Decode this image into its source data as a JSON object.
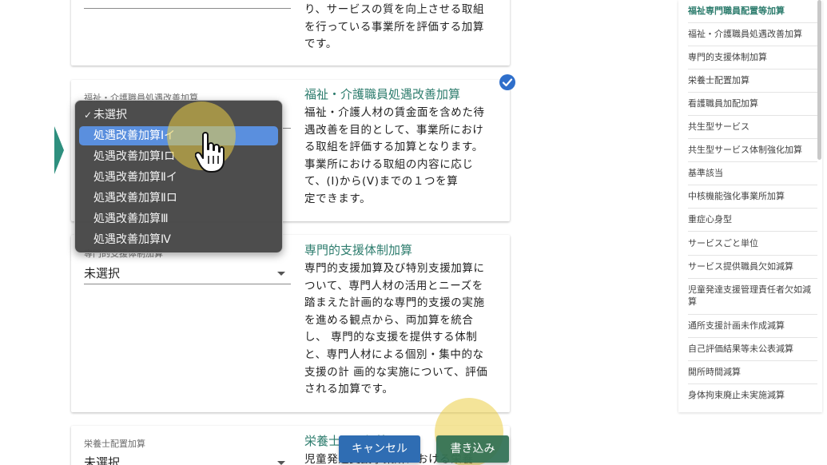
{
  "card0": {
    "desc_lines": [
      "り、サービスの質を向上させる取組",
      "を行っている事業所を評価する加算",
      "です。"
    ]
  },
  "card1": {
    "label": "福祉・介護職員処遇改善加算",
    "title": "福祉・介護職員処遇改善加算",
    "desc_lines": [
      "福祉・介護人材の賃金面を含めた待",
      "遇改善を目的として、事業所におけ",
      "る取組を評価する加算となります。",
      "事業所における取組の内容に応じ",
      "て、(Ⅰ)から(Ⅴ)までの１つを算",
      "定できます。"
    ],
    "checked": true
  },
  "dropdown": {
    "check_mark": "✓",
    "options": [
      "未選択",
      "処遇改善加算Ⅰイ",
      "処遇改善加算Ⅰロ",
      "処遇改善加算Ⅱイ",
      "処遇改善加算Ⅱロ",
      "処遇改善加算Ⅲ",
      "処遇改善加算Ⅳ"
    ],
    "checked_option": "未選択",
    "hovered_option": "処遇改善加算Ⅰイ"
  },
  "card2": {
    "label": "専門的支援体制加算",
    "value": "未選択",
    "title": "専門的支援体制加算",
    "desc_lines": [
      "専門的支援加算及び特別支援加算に",
      "ついて、専門人材の活用とニーズを",
      "踏まえた計画的な専門的支援の実施",
      "を進める観点から、両加算を統合",
      "し、 専門的な支援を提供する体制",
      "と、専門人材による個別・集中的な",
      "支援の計 画的な実施について、評価",
      "される加算です。"
    ]
  },
  "card3": {
    "label": "栄養士配置加算",
    "value": "未選択",
    "title": "栄養士配置加算",
    "desc_lines": [
      "児童発達支援事業所における栄養"
    ]
  },
  "buttons": {
    "cancel": "キャンセル",
    "save": "書き込み"
  },
  "colors": {
    "cancel": "#2f6db3",
    "save": "#2e6f52",
    "accent": "#2e7d6e",
    "check": "#2f6fcb",
    "arrow": "#2e8f7e"
  },
  "side_nav": {
    "items": [
      "福祉専門職員配置等加算",
      "福祉・介護職員処遇改善加算",
      "専門的支援体制加算",
      "栄養士配置加算",
      "看護職員加配加算",
      "共生型サービス",
      "共生型サービス体制強化加算",
      "基準該当",
      "中核機能強化事業所加算",
      "重症心身型",
      "サービスごと単位",
      "サービス提供職員欠如減算",
      "児童発達支援管理責任者欠如減算",
      "通所支援計画未作成減算",
      "自己評価結果等未公表減算",
      "開所時間減算",
      "身体拘束廃止未実施減算"
    ],
    "active_item": "福祉専門職員配置等加算"
  },
  "icons": {
    "check_circle": "check-circle-icon",
    "pointer": "hand-pointer-icon",
    "caret": "caret-down-icon",
    "expand": "expand-arrow-icon"
  }
}
